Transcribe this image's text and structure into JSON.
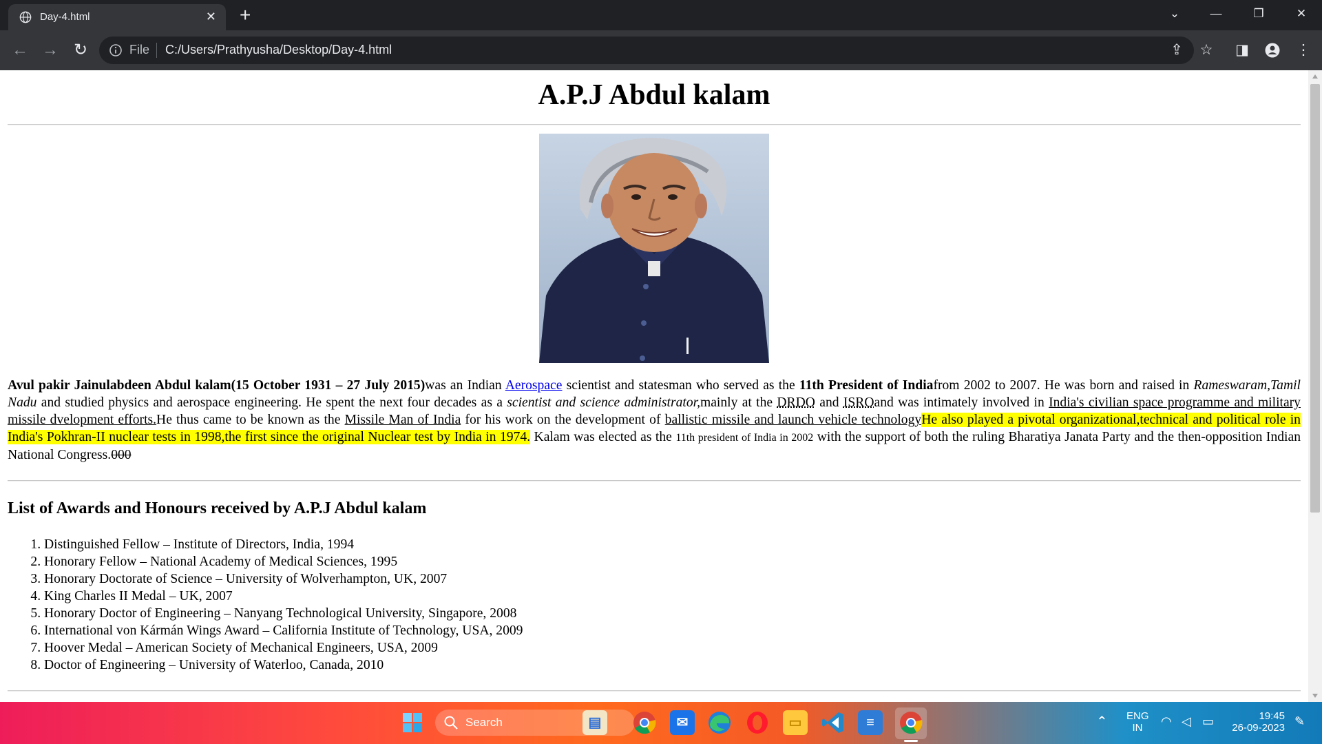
{
  "browser": {
    "tab_title": "Day-4.html",
    "new_tab": "+",
    "close_tab": "✕",
    "address_prefix": "File",
    "url": "C:/Users/Prathyusha/Desktop/Day-4.html"
  },
  "page": {
    "heading": "A.P.J Abdul kalam",
    "bio": {
      "name_dates": "Avul pakir Jainulabdeen Abdul kalam(15 October 1931 – 27 July 2015)",
      "t1": "was an Indian ",
      "link_aerospace": "Aerospace",
      "t2": " scientist and statesman who served as the ",
      "president_bold": "11th President of India",
      "t3": "from 2002 to 2007. He was born and raised in ",
      "birthplace_italic": "Rameswaram,Tamil Nadu",
      "t4": " and studied physics and aerospace engineering. He spent the next four decades as a ",
      "role_italic": "scientist and science administrator,",
      "t5": "mainly at the ",
      "abbr_drdo": "DRDO",
      "t6": " and ",
      "abbr_isro": "ISRO",
      "t7": "and was intimately involved in ",
      "u_space": "India's civilian space programme and military missile dvelopment efforts.",
      "t8": "He thus came to be known as the ",
      "u_missile_man": "Missile Man of India",
      "t9": " for his work on the development of ",
      "u_ballistic": "ballistic missile and launch vehicle technology",
      "highlight": "He also played a pivotal organizational,technical and political role in India's Pokhran-II nuclear tests in 1998,the first since the original Nuclear test by India in 1974.",
      "t10": " Kalam was elected as the ",
      "small_text": "11th president of India in 2002",
      "t11": " with the support of both the ruling Bharatiya Janata Party and the then-opposition Indian National Congress.",
      "strike": "000"
    },
    "awards_heading": "List of Awards and Honours received by A.P.J Abdul kalam",
    "awards": [
      "Distinguished Fellow – Institute of Directors, India, 1994",
      "Honorary Fellow – National Academy of Medical Sciences, 1995",
      "Honorary Doctorate of Science – University of Wolverhampton, UK, 2007",
      "King Charles II Medal – UK, 2007",
      "Honorary Doctor of Engineering – Nanyang Technological University, Singapore, 2008",
      "International von Kármán Wings Award – California Institute of Technology, USA, 2009",
      "Hoover Medal – American Society of Mechanical Engineers, USA, 2009",
      "Doctor of Engineering – University of Waterloo, Canada, 2010"
    ]
  },
  "taskbar": {
    "search_label": "Search",
    "lang_top": "ENG",
    "lang_bottom": "IN",
    "time": "19:45",
    "date": "26-09-2023"
  },
  "icons": {
    "tab": "globe-icon",
    "address": "info-icon",
    "toolbar": [
      "share-icon",
      "star-icon",
      "sidebar-icon",
      "profile-icon",
      "menu-icon"
    ],
    "taskbar_apps": [
      "files-photos-icon",
      "chrome-icon",
      "mail-icon",
      "edge-icon",
      "opera-icon",
      "file-explorer-icon",
      "vscode-icon",
      "notepad-icon",
      "chrome-active-icon"
    ]
  },
  "colors": {
    "chrome_dark": "#202124",
    "chrome_toolbar": "#35363a",
    "link": "#0000ee",
    "highlight": "#ffff00"
  }
}
